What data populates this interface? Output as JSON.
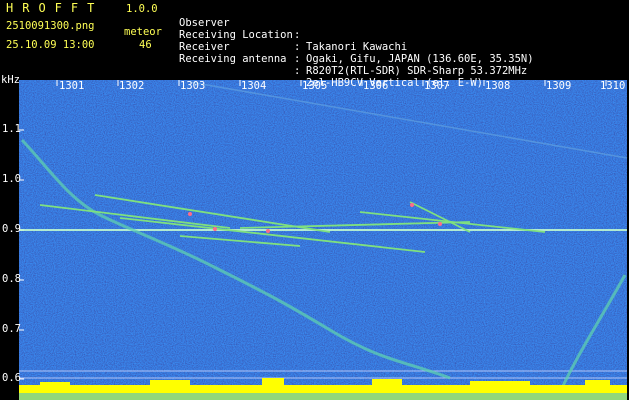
{
  "app": {
    "title": "HROFFT",
    "version": "1.0.0"
  },
  "file_name": "2510091300.png",
  "datetime": "25.10.09 13:00",
  "meteor": {
    "label": "meteor",
    "count": "46"
  },
  "info": [
    {
      "key": "Observer",
      "value": "Takanori Kawachi"
    },
    {
      "key": "Receiving Location",
      "value": "Ogaki, Gifu, JAPAN (136.60E, 35.35N)"
    },
    {
      "key": "Receiver",
      "value": "R820T2(RTL-SDR) SDR-Sharp 53.372MHz"
    },
    {
      "key": "Receiving antenna",
      "value": "2el-HB9CV Vertical (el. E-W)"
    }
  ],
  "y_axis": {
    "unit": "kHz",
    "ticks": [
      "1.1",
      "1.0",
      "0.9",
      "0.8",
      "0.7",
      "0.6"
    ]
  },
  "x_axis": {
    "ticks": [
      "1301",
      "1302",
      "1303",
      "1304",
      "1305",
      "1306",
      "1307",
      "1308",
      "1309",
      "1310"
    ]
  },
  "colors": {
    "background": "#0a1a6e",
    "trace": "#7fe07f",
    "carrier": "#c8ffd0",
    "noise_bars": "#ffff00",
    "text_yellow": "#ffff55",
    "text_white": "#ffffff"
  }
}
